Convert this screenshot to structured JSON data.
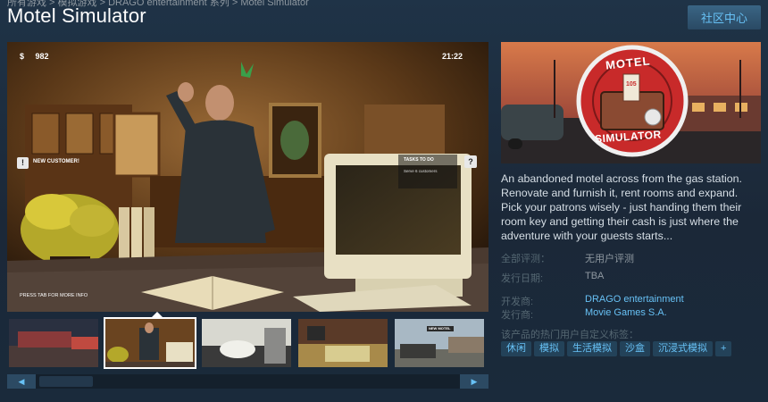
{
  "breadcrumb": "所有游戏 > 模拟游戏 > DRAGO entertainment 系列 > Motel Simulator",
  "title": "Motel Simulator",
  "community_button": "社区中心",
  "screenshot_hud": {
    "money_symbol": "$",
    "money": "982",
    "clock": "21:22",
    "notification_icon": "!",
    "notification": "NEW CUSTOMER!",
    "tasks_title": "TASKS TO DO",
    "tasks_item": "Serve 6 customers",
    "help_icon": "?",
    "hint": "PRESS TAB FOR MORE INFO"
  },
  "capsule": {
    "logo_top": "MOTEL",
    "logo_bottom": "SIMULATOR",
    "key_tag": "105"
  },
  "thumb_overlay": "NEW MOTEL",
  "scroll": {
    "left": "◀",
    "right": "▶"
  },
  "description": "An abandoned motel across from the gas station. Renovate and furnish it, rent rooms and expand. Pick your patrons wisely - just handing them their room key and getting their cash is just where the adventure with your guests starts...",
  "info": {
    "reviews_label": "全部评测：",
    "reviews_value": "无用户评测",
    "release_label": "发行日期:",
    "release_value": "TBA",
    "developer_label": "开发商:",
    "developer_value": "DRAGO entertainment",
    "publisher_label": "发行商:",
    "publisher_value": "Movie Games S.A."
  },
  "tags_title": "该产品的热门用户自定义标签：",
  "tags": [
    "休闲",
    "模拟",
    "生活模拟",
    "沙盒",
    "沉浸式模拟",
    "+"
  ],
  "colors": {
    "accent": "#67c1f5",
    "background": "#1b2838",
    "label": "#556772"
  }
}
